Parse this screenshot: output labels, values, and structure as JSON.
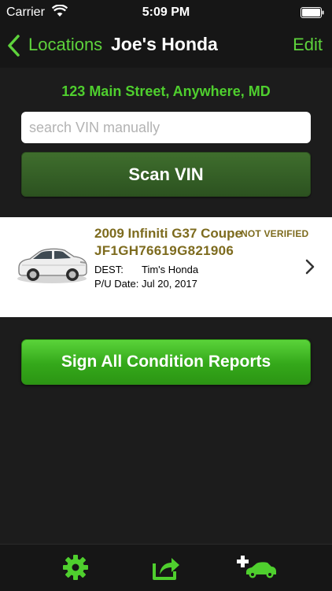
{
  "status_bar": {
    "carrier": "Carrier",
    "time": "5:09 PM"
  },
  "nav": {
    "back_label": "Locations",
    "title": "Joe's Honda",
    "edit_label": "Edit"
  },
  "address": "123 Main Street, Anywhere, MD",
  "search": {
    "placeholder": "search VIN manually",
    "value": ""
  },
  "scan_button_label": "Scan VIN",
  "vehicle": {
    "name": "2009 Infiniti G37 Coupe",
    "status": "NOT VERIFIED",
    "vin": "JF1GH76619G821906",
    "dest_label": "DEST:",
    "dest_value": "Tim's Honda",
    "pu_label": "P/U Date:",
    "pu_value": "Jul 20, 2017"
  },
  "sign_button_label": "Sign All Condition Reports",
  "tab_bar": {
    "icons": [
      "gear-icon",
      "share-icon",
      "add-car-icon"
    ]
  },
  "colors": {
    "accent_green": "#5ed33c",
    "vehicle_text": "#7d6b1e",
    "background": "#1c1c1c"
  }
}
